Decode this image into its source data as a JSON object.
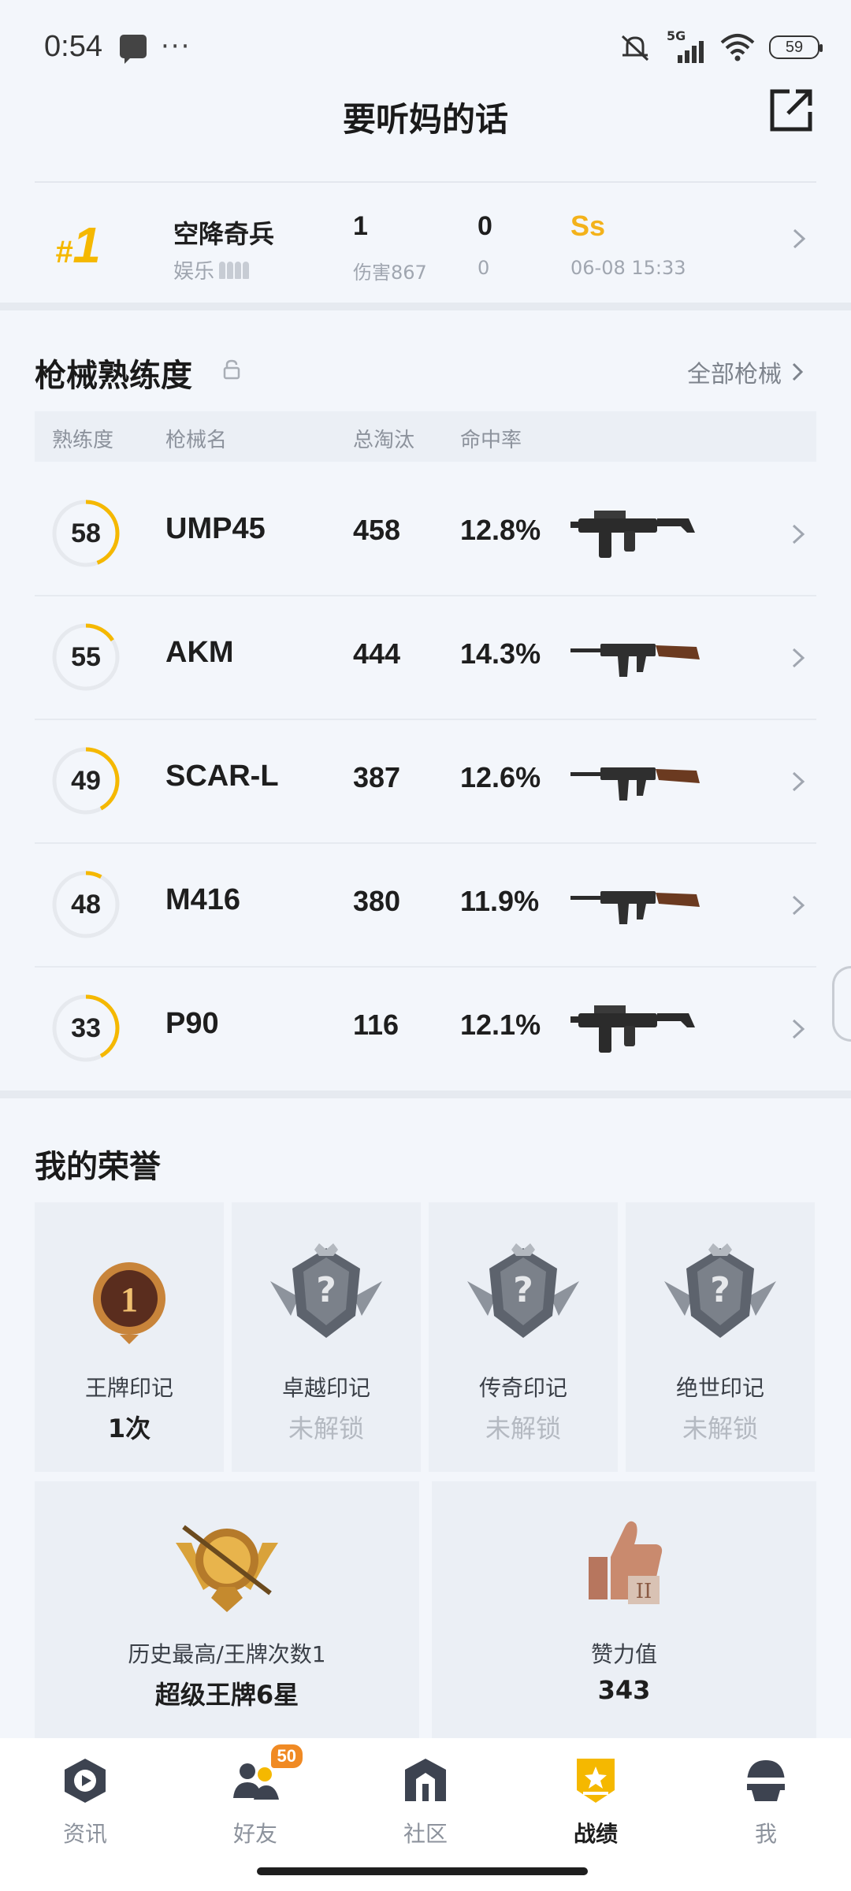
{
  "status_bar": {
    "time": "0:54",
    "network": "5G",
    "wifi_sub": "6",
    "battery": "59"
  },
  "header": {
    "title": "要听妈的话"
  },
  "recent_match": {
    "rank": "1",
    "mode": "空降奇兵",
    "sub_mode": "娱乐",
    "kills": "1",
    "damage_label": "伤害867",
    "assists": "0",
    "assists_sub": "0",
    "grade": "Ss",
    "time": "06-08 15:33"
  },
  "guns": {
    "title": "枪械熟练度",
    "all_link": "全部枪械",
    "headers": {
      "proficiency": "熟练度",
      "name": "枪械名",
      "kills": "总淘汰",
      "accuracy": "命中率"
    },
    "rows": [
      {
        "proficiency": "58",
        "progress": 0.44,
        "name": "UMP45",
        "kills": "458",
        "accuracy": "12.8%",
        "weapon_icon": "smg-icon"
      },
      {
        "proficiency": "55",
        "progress": 0.16,
        "name": "AKM",
        "kills": "444",
        "accuracy": "14.3%",
        "weapon_icon": "rifle-icon"
      },
      {
        "proficiency": "49",
        "progress": 0.42,
        "name": "SCAR-L",
        "kills": "387",
        "accuracy": "12.6%",
        "weapon_icon": "rifle-icon"
      },
      {
        "proficiency": "48",
        "progress": 0.08,
        "name": "M416",
        "kills": "380",
        "accuracy": "11.9%",
        "weapon_icon": "rifle-icon"
      },
      {
        "proficiency": "33",
        "progress": 0.42,
        "name": "P90",
        "kills": "116",
        "accuracy": "12.1%",
        "weapon_icon": "smg-icon"
      }
    ]
  },
  "honors": {
    "title": "我的荣誉",
    "badges": [
      {
        "label": "王牌印记",
        "value": "1次",
        "locked": false
      },
      {
        "label": "卓越印记",
        "value": "未解锁",
        "locked": true
      },
      {
        "label": "传奇印记",
        "value": "未解锁",
        "locked": true
      },
      {
        "label": "绝世印记",
        "value": "未解锁",
        "locked": true
      }
    ],
    "highest": {
      "label": "历史最高/王牌次数1",
      "value": "超级王牌6星"
    },
    "likes": {
      "label": "赞力值",
      "value": "343"
    }
  },
  "nav": {
    "items": [
      {
        "label": "资讯",
        "icon": "news-icon"
      },
      {
        "label": "好友",
        "icon": "friends-icon",
        "badge": "50"
      },
      {
        "label": "社区",
        "icon": "community-icon"
      },
      {
        "label": "战绩",
        "icon": "record-icon",
        "active": true
      },
      {
        "label": "我",
        "icon": "profile-icon"
      }
    ]
  },
  "colors": {
    "accent": "#f5b800",
    "ring_track": "#e6e9ee",
    "ring_fill": "#f5b800"
  }
}
